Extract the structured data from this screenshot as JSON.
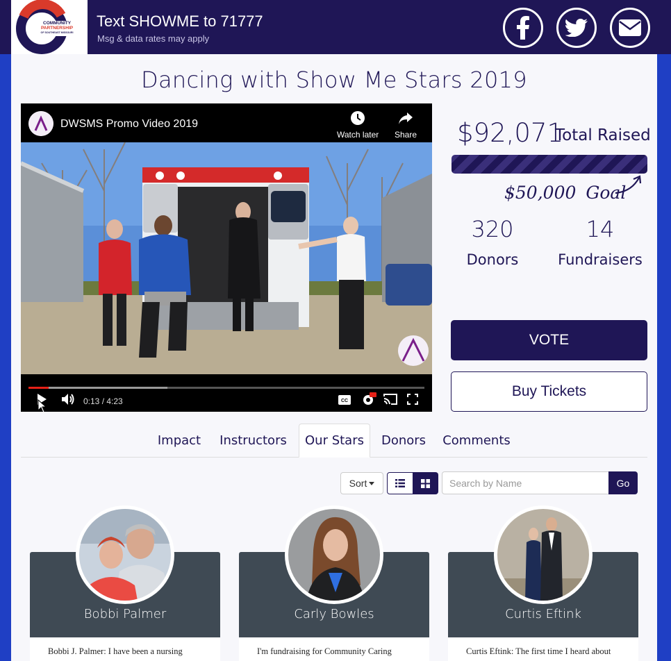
{
  "header": {
    "logo_line1": "COMMUNITY",
    "logo_line2": "PARTNERSHIP",
    "logo_line3": "OF SOUTHEAST MISSOURI",
    "title": "Text SHOWME to 71777",
    "subtitle": "Msg & data rates may apply",
    "social": [
      {
        "name": "facebook-icon"
      },
      {
        "name": "twitter-icon"
      },
      {
        "name": "email-icon"
      }
    ]
  },
  "page": {
    "title": "Dancing with Show Me Stars 2019"
  },
  "video": {
    "title": "DWSMS Promo Video 2019",
    "watch_later": "Watch later",
    "share": "Share",
    "time": "0:13 / 4:23",
    "played_fraction": 0.05,
    "buffered_fraction": 0.35
  },
  "stats": {
    "raised_amount": "$92,071",
    "raised_label": "Total Raised",
    "goal_amount": "$50,000",
    "goal_label": "Goal",
    "donors_count": "320",
    "donors_label": "Donors",
    "fundraisers_count": "14",
    "fundraisers_label": "Fundraisers"
  },
  "buttons": {
    "vote": "VOTE",
    "tickets": "Buy Tickets"
  },
  "tabs": [
    {
      "label": "Impact",
      "active": false
    },
    {
      "label": "Instructors",
      "active": false
    },
    {
      "label": "Our Stars",
      "active": true
    },
    {
      "label": "Donors",
      "active": false
    },
    {
      "label": "Comments",
      "active": false
    }
  ],
  "toolbar": {
    "sort_label": "Sort",
    "search_placeholder": "Search by Name",
    "go_label": "Go"
  },
  "stars": [
    {
      "name": "Bobbi Palmer",
      "excerpt": "Bobbi J. Palmer:  I have been a nursing"
    },
    {
      "name": "Carly Bowles",
      "excerpt": "I'm fundraising for Community Caring"
    },
    {
      "name": "Curtis Eftink",
      "excerpt": "Curtis Eftink: The first time I heard about"
    }
  ],
  "colors": {
    "brand": "#1f1656",
    "side": "#1f3fc4",
    "accent_red": "#d93a2b",
    "card": "#3f4a54"
  }
}
